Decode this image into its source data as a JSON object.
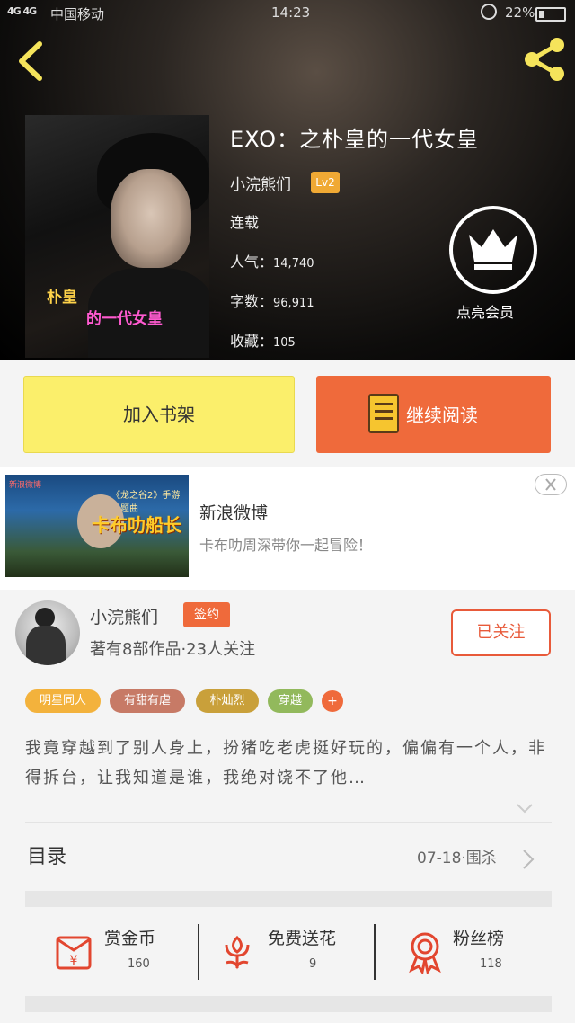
{
  "status_bar": {
    "signal": "4G 4G",
    "carrier": "中国移动",
    "time": "14:23",
    "battery": "22%",
    "battery_level": 0.22
  },
  "book": {
    "title": "EXO：之朴皇的一代女皇",
    "cover_text_line1": "朴皇",
    "cover_text_line2": "的一代女皇",
    "author": "小浣熊们",
    "author_level": "Lv2",
    "status": "连载",
    "popularity_label": "人气：",
    "popularity": "14,740",
    "words_label": "字数：",
    "words": "96,911",
    "favorites_label": "收藏：",
    "favorites": "105",
    "vip_label": "点亮会员"
  },
  "actions": {
    "add_to_shelf": "加入书架",
    "continue_reading": "继续阅读"
  },
  "ad": {
    "brand": "新浪微博",
    "image_headline": "卡布叻船长",
    "image_subtitle": "《龙之谷2》手游主题曲",
    "title": "新浪微博",
    "subtitle": "卡布叻周深带你一起冒险！"
  },
  "author_section": {
    "name": "小浣熊们",
    "badge": "签约",
    "stats": "著有8部作品·23人关注",
    "follow_label": "已关注"
  },
  "tags": [
    {
      "label": "明星同人",
      "color": "#f3b23c"
    },
    {
      "label": "有甜有虐",
      "color": "#c77a66"
    },
    {
      "label": "朴灿烈",
      "color": "#c9a03a"
    },
    {
      "label": "穿越",
      "color": "#92b95c"
    }
  ],
  "tag_more": "+",
  "description": "我竟穿越到了别人身上，扮猪吃老虎挺好玩的，偏偏有一个人，非得拆台，让我知道是谁，我绝对饶不了他…",
  "catalog": {
    "label": "目录",
    "latest": "07-18·围杀"
  },
  "rewards": [
    {
      "label": "赏金币",
      "count": "160",
      "icon": "red-envelope-icon"
    },
    {
      "label": "免费送花",
      "count": "9",
      "icon": "flower-icon"
    },
    {
      "label": "粉丝榜",
      "count": "118",
      "icon": "medal-icon"
    }
  ],
  "colors": {
    "accent_orange": "#ef6a3b",
    "button_yellow": "#fbef6b",
    "icon_red": "#e2462f",
    "header_dark": "#0d0c0b"
  }
}
